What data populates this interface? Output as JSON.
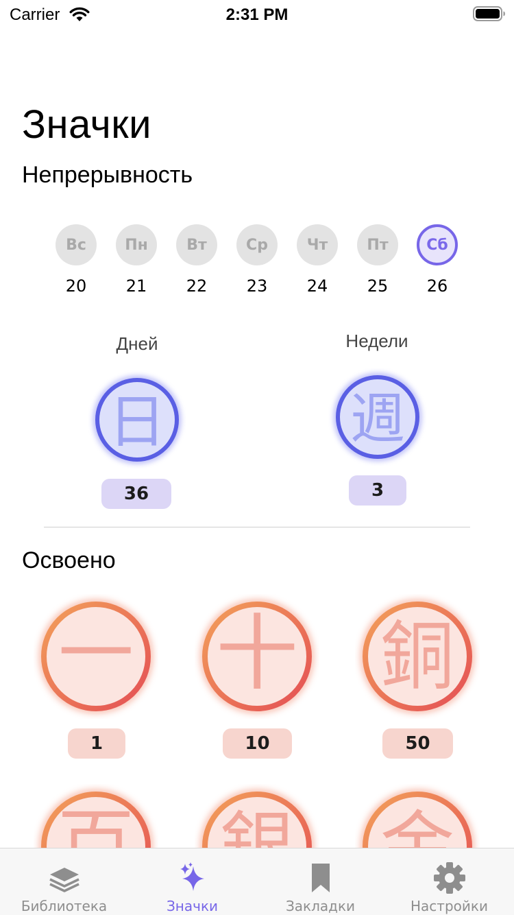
{
  "status_bar": {
    "carrier": "Carrier",
    "time": "2:31 PM"
  },
  "page": {
    "title": "Значки"
  },
  "streak": {
    "title": "Непрерывность",
    "weekdays": [
      {
        "label": "Вс",
        "date": "20",
        "active": false
      },
      {
        "label": "Пн",
        "date": "21",
        "active": false
      },
      {
        "label": "Вт",
        "date": "22",
        "active": false
      },
      {
        "label": "Ср",
        "date": "23",
        "active": false
      },
      {
        "label": "Чт",
        "date": "24",
        "active": false
      },
      {
        "label": "Пт",
        "date": "25",
        "active": false
      },
      {
        "label": "Сб",
        "date": "26",
        "active": true
      }
    ],
    "days": {
      "label": "Дней",
      "glyph": "日",
      "count": "36"
    },
    "weeks": {
      "label": "Недели",
      "glyph": "週",
      "count": "3"
    }
  },
  "mastered": {
    "title": "Освоено",
    "badges": [
      {
        "glyph": "一",
        "count": "1"
      },
      {
        "glyph": "十",
        "count": "10"
      },
      {
        "glyph": "銅",
        "count": "50"
      },
      {
        "glyph": "百",
        "count": ""
      },
      {
        "glyph": "銀",
        "count": ""
      },
      {
        "glyph": "金",
        "count": ""
      }
    ]
  },
  "tabs": [
    {
      "label": "Библиотека",
      "icon": "layers-icon",
      "active": false
    },
    {
      "label": "Значки",
      "icon": "sparkles-icon",
      "active": true
    },
    {
      "label": "Закладки",
      "icon": "bookmark-icon",
      "active": false
    },
    {
      "label": "Настройки",
      "icon": "gear-icon",
      "active": false
    }
  ],
  "colors": {
    "accent": "#7766e8",
    "streak_ring": "#5a5fe4",
    "mastery_ring": "#ec6a4c"
  }
}
